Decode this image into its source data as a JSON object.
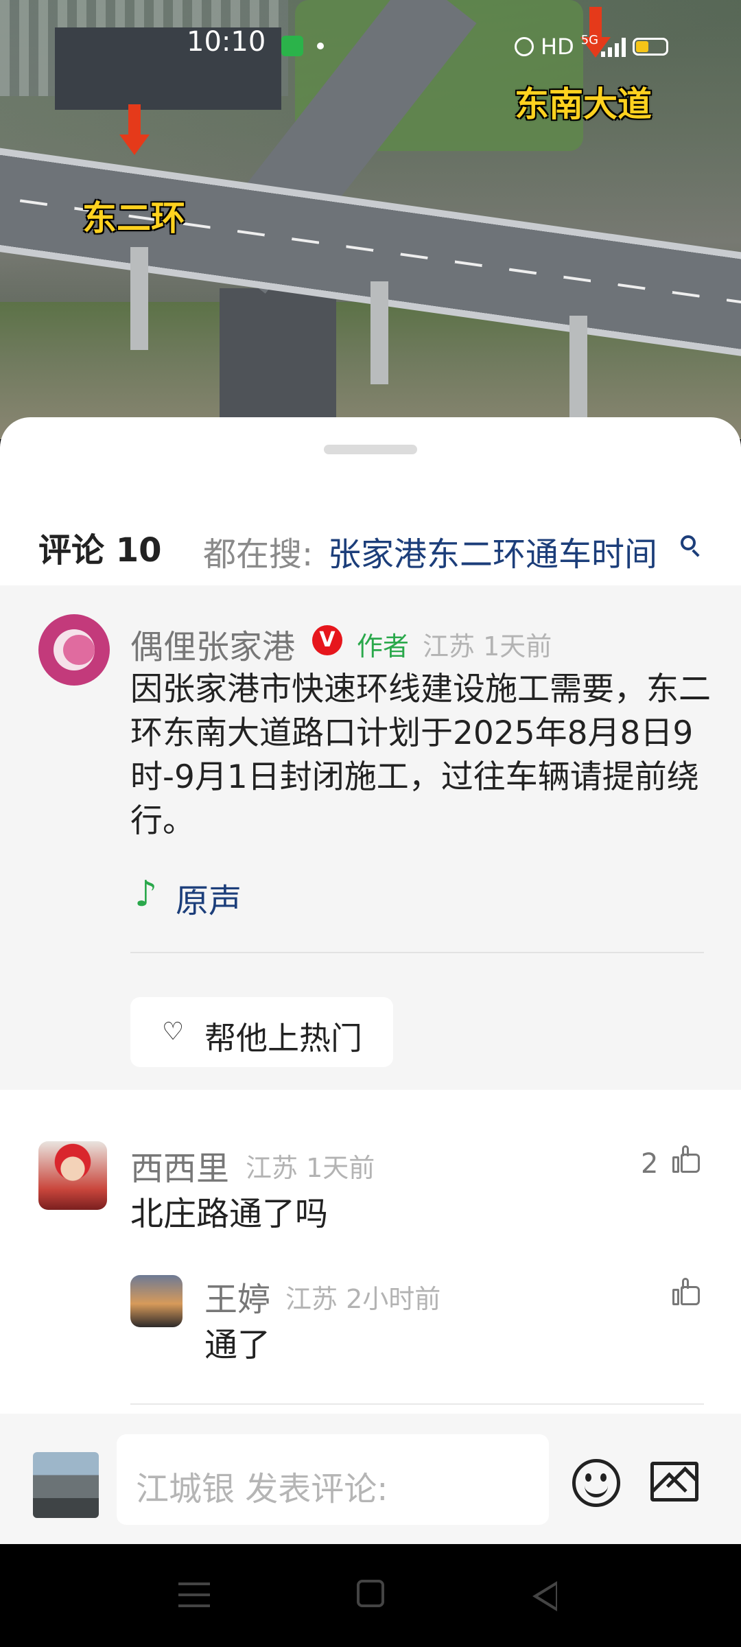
{
  "status_bar": {
    "time": "10:10",
    "network_label": "HD",
    "network_type": "5G"
  },
  "video": {
    "overlay_labels": [
      "东二环",
      "东南大道"
    ]
  },
  "comments_panel": {
    "title": "评论 10",
    "search_prefix": "都在搜:",
    "search_term": "张家港东二环通车时间",
    "pinned": {
      "author_name": "偶俚张家港",
      "verified_badge": "V",
      "author_tag": "作者",
      "meta": "江苏 1天前",
      "text": "因张家港市快速环线建设施工需要，东二环东南大道路口计划于2025年8月8日9时-9月1日封闭施工，过往车辆请提前绕行。",
      "sound_label": "原声",
      "boost_button": "帮他上热门"
    },
    "comments": [
      {
        "user": "西西里",
        "meta": "江苏 1天前",
        "text": "北庄路通了吗",
        "likes": "2"
      },
      {
        "user": "王婷",
        "meta": "江苏 2小时前",
        "text": "通了",
        "likes": ""
      }
    ]
  },
  "bottom_bar": {
    "input_placeholder": "江城银 发表评论:"
  },
  "icons": {
    "verified": "verified-icon",
    "music": "music-note-icon",
    "heart": "heart-icon",
    "like": "thumbs-up-icon",
    "emoji": "emoji-icon",
    "image": "image-icon"
  },
  "colors": {
    "link_blue": "#1c3e7a",
    "author_green": "#2aa84b",
    "verified_red": "#e6161c",
    "overlay_yellow": "#ffd21f"
  }
}
